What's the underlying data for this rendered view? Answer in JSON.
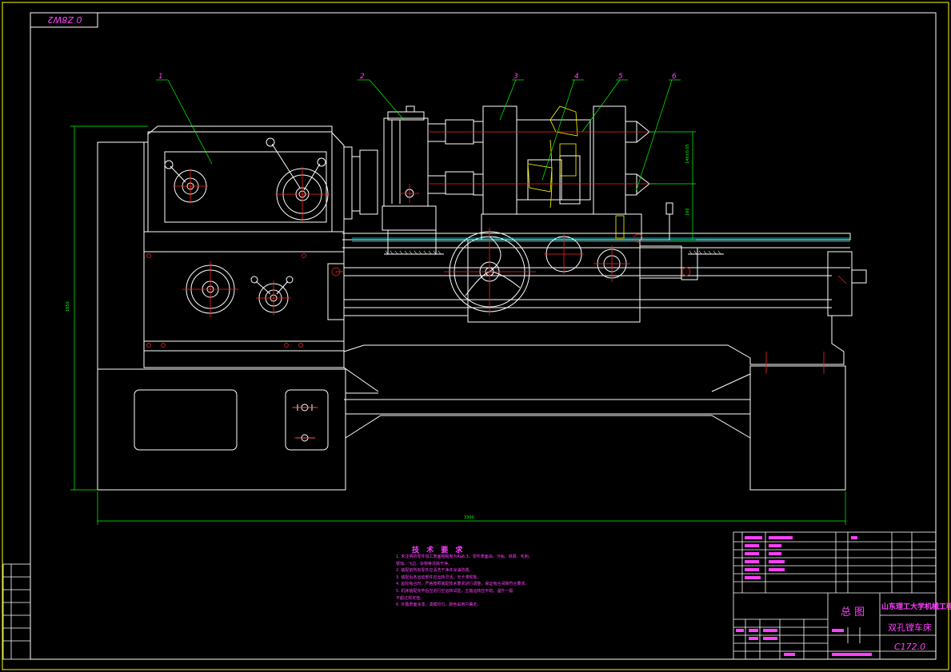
{
  "sheet": {
    "code_rotated": "0 Z8W2"
  },
  "balloons": [
    "1",
    "2",
    "3",
    "4",
    "5",
    "6"
  ],
  "technical_requirements": {
    "title": "技 术 要 求",
    "items": [
      "1. 未注明的零件加工表面粗糙度为Ra6.3。零件表面油、污垢、铁屑、毛刺、",
      "   锈蚀、飞边、杂物等清除干净。",
      "2. 装配前所有零件应清洗干净并涂油防锈。",
      "3. 装配后各运动部件应运转灵活，无卡滞现象。",
      "4. 齿轮啮合时，严格按照装配技术要求进行调整，保证啮合间隙符合要求。",
      "5. 机床装配完毕后应进行空运转试验，主轴运转应平稳，温升一般",
      "   不超过规定值。",
      "6. 外露表面涂漆，漆膜均匀，颜色由用户确定。"
    ]
  },
  "title_block": {
    "school": "山东理工大学机械工程学院",
    "drawing_name": "总 图",
    "machine_name": "双孔镗车床",
    "drawing_number": "C172.0"
  },
  "colors": {
    "frame": "#ffff00",
    "outline": "#ffffff",
    "centerline": "#ff2020",
    "dimension": "#00ff00",
    "magenta": "#ff40ff",
    "cyan": "#00ffff"
  }
}
